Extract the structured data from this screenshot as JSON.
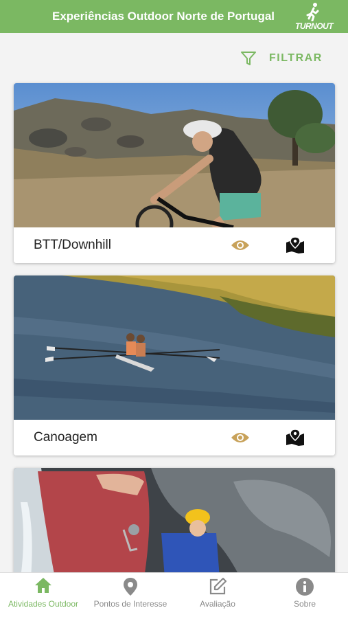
{
  "header": {
    "title": "Experiências Outdoor Norte de Portugal",
    "logo_text": "TURNOUT"
  },
  "filter": {
    "label": "FILTRAR"
  },
  "activities": [
    {
      "name": "BTT/Downhill"
    },
    {
      "name": "Canoagem"
    },
    {
      "name": ""
    }
  ],
  "tabs": [
    {
      "label": "Atividades Outdoor"
    },
    {
      "label": "Pontos de Interesse"
    },
    {
      "label": "Avaliação"
    },
    {
      "label": "Sobre"
    }
  ],
  "colors": {
    "accent": "#7bb862",
    "eye": "#c8a25a"
  }
}
